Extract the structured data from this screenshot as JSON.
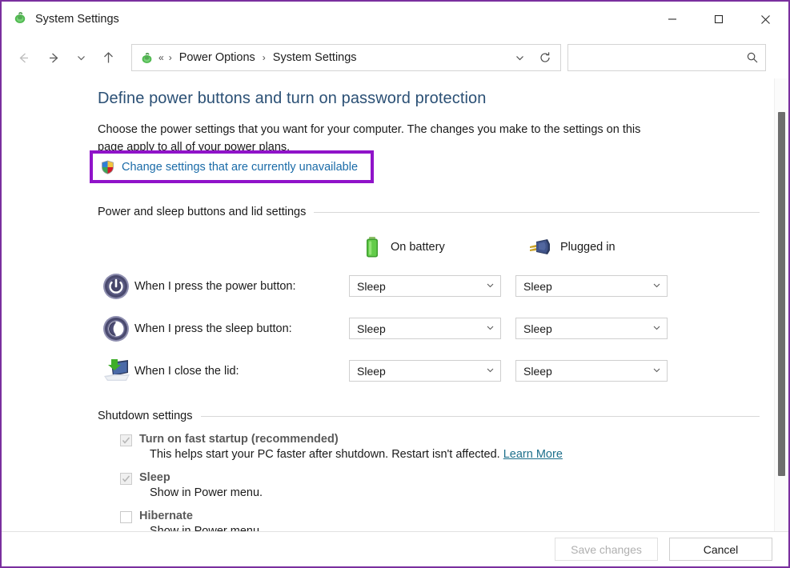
{
  "window": {
    "title": "System Settings",
    "app_icon": "power-options-icon",
    "border_color": "#7a2f9e",
    "controls": {
      "minimize": "minimize-button",
      "maximize": "maximize-button",
      "close": "close-button"
    }
  },
  "navbar": {
    "back": "back-button",
    "forward": "forward-button",
    "recent": "recent-locations-button",
    "up": "up-button",
    "breadcrumb": {
      "icon": "power-options-icon",
      "overflow": "«",
      "items": [
        "Power Options",
        "System Settings"
      ],
      "separator": "›"
    },
    "dropdown": "address-dropdown-button",
    "refresh": "refresh-button",
    "search": {
      "value": "",
      "placeholder": ""
    }
  },
  "page": {
    "title": "Define power buttons and turn on password protection",
    "description": "Choose the power settings that you want for your computer. The changes you make to the settings on this page apply to all of your power plans.",
    "uac_link": {
      "label": "Change settings that are currently unavailable",
      "icon": "shield-icon",
      "highlight_color": "#9013c9"
    }
  },
  "power_section": {
    "heading": "Power and sleep buttons and lid settings",
    "columns": [
      {
        "label": "On battery",
        "icon": "battery-icon"
      },
      {
        "label": "Plugged in",
        "icon": "power-plug-icon"
      }
    ],
    "rows": [
      {
        "icon": "power-button-icon",
        "label": "When I press the power button:",
        "on_battery": "Sleep",
        "plugged_in": "Sleep"
      },
      {
        "icon": "sleep-moon-icon",
        "label": "When I press the sleep button:",
        "on_battery": "Sleep",
        "plugged_in": "Sleep"
      },
      {
        "icon": "laptop-lid-icon",
        "label": "When I close the lid:",
        "on_battery": "Sleep",
        "plugged_in": "Sleep"
      }
    ]
  },
  "shutdown_section": {
    "heading": "Shutdown settings",
    "options": [
      {
        "label": "Turn on fast startup (recommended)",
        "checked": true,
        "description": "This helps start your PC faster after shutdown. Restart isn't affected.",
        "link": "Learn More"
      },
      {
        "label": "Sleep",
        "checked": true,
        "description": "Show in Power menu.",
        "link": ""
      },
      {
        "label": "Hibernate",
        "checked": false,
        "description": "Show in Power menu.",
        "link": ""
      }
    ]
  },
  "footer": {
    "save_label": "Save changes",
    "save_enabled": false,
    "cancel_label": "Cancel"
  }
}
